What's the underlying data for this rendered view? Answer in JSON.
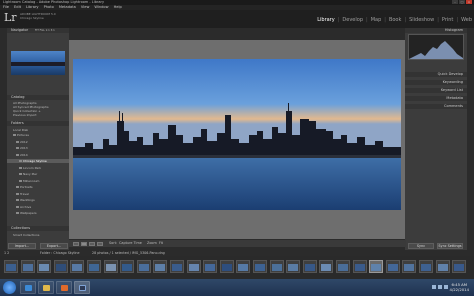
{
  "window": {
    "title": "Lightroom Catalog - Adobe Photoshop Lightroom - Library",
    "buttons": [
      "–",
      "□",
      "×"
    ]
  },
  "menu": [
    "File",
    "Edit",
    "Library",
    "Photo",
    "Metadata",
    "View",
    "Window",
    "Help"
  ],
  "identity": {
    "logo": "Lr",
    "line1": "ADOBE LIGHTROOM 5.0",
    "line2": "Chicago Skyline"
  },
  "modules": [
    {
      "label": "Library",
      "active": true
    },
    {
      "label": "Develop",
      "active": false
    },
    {
      "label": "Map",
      "active": false
    },
    {
      "label": "Book",
      "active": false
    },
    {
      "label": "Slideshow",
      "active": false
    },
    {
      "label": "Print",
      "active": false
    },
    {
      "label": "Web",
      "active": false
    }
  ],
  "left_panel": {
    "navigator": {
      "title": "Navigator",
      "modes": "FIT  FILL  1:1  3:1"
    },
    "catalog": {
      "title": "Catalog",
      "items": [
        "All Photographs",
        "All Synced Photographs",
        "Quick Collection +",
        "Previous Import"
      ]
    },
    "folders": {
      "title": "Folders",
      "volume": "Local Disk",
      "items": [
        {
          "label": "Pictures",
          "selected": false,
          "indent": 2
        },
        {
          "label": "2012",
          "selected": false,
          "indent": 3
        },
        {
          "label": "2013",
          "selected": false,
          "indent": 3
        },
        {
          "label": "2014",
          "selected": false,
          "indent": 3
        },
        {
          "label": "Chicago Skyline",
          "selected": true,
          "indent": 4
        },
        {
          "label": "Lincoln Park",
          "selected": false,
          "indent": 4
        },
        {
          "label": "Navy Pier",
          "selected": false,
          "indent": 4
        },
        {
          "label": "Millennium",
          "selected": false,
          "indent": 4
        },
        {
          "label": "Portraits",
          "selected": false,
          "indent": 3
        },
        {
          "label": "Travel",
          "selected": false,
          "indent": 3
        },
        {
          "label": "Weddings",
          "selected": false,
          "indent": 3
        },
        {
          "label": "Archive",
          "selected": false,
          "indent": 3
        },
        {
          "label": "Wallpapers",
          "selected": false,
          "indent": 3
        }
      ]
    },
    "collections": {
      "title": "Collections",
      "items": [
        "Smart Collections"
      ]
    },
    "import_btn": "Import...",
    "export_btn": "Export..."
  },
  "right_panel": {
    "histogram": "Histogram",
    "sections": [
      "Quick Develop",
      "Keywording",
      "Keyword List",
      "Metadata",
      "Comments"
    ],
    "sync_btn": "Sync",
    "sync_settings_btn": "Sync Settings"
  },
  "toolbar": {
    "sort_label": "Sort:",
    "sort_value": "Capture Time",
    "zoom_label": "Zoom",
    "zoom_value": "Fit"
  },
  "filmstrip_header": {
    "source": "Folder : Chicago Skyline",
    "count": "28 photos / 1 selected / IMG_5306-Pano.dng"
  },
  "clock": {
    "time": "6:45 AM",
    "date": "4/22/2014"
  },
  "colors": {
    "accent_active": "#ffffff",
    "panel_bg": "#3c3c3c",
    "center_bg": "#6e6e6e"
  }
}
